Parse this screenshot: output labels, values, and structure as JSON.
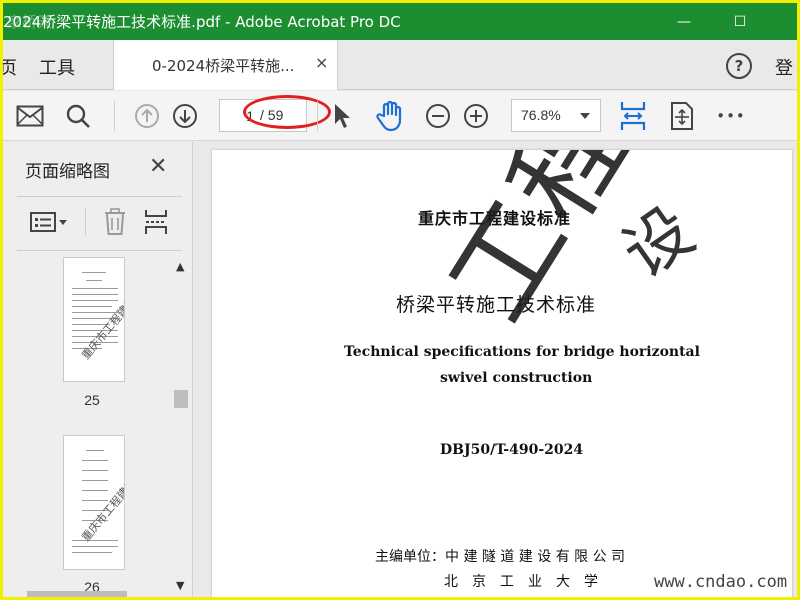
{
  "window": {
    "title": "2024桥梁平转施工技术标准.pdf - Adobe Acrobat Pro DC",
    "corner_watermark": "家桥天",
    "minimize": "—",
    "maximize": "☐"
  },
  "menubar": {
    "home_partial": "页",
    "tools": "工具",
    "tab_label": "0-2024桥梁平转施...",
    "tab_close": "×",
    "help": "?",
    "login_partial": "登"
  },
  "toolbar": {
    "current_page": "1",
    "total_pages": "/ 59",
    "zoom": "76.8%",
    "more": "•••"
  },
  "sidepanel": {
    "title": "页面缩略图",
    "close": "✕",
    "thumb_watermark": "重庆市工程建设",
    "pages": [
      {
        "number": "25"
      },
      {
        "number": "26"
      }
    ]
  },
  "document": {
    "header": "重庆市工程建设标准",
    "title_cn": "桥梁平转施工技术标准",
    "title_en_line1": "Technical specifications for bridge horizontal",
    "title_en_line2": "swivel construction",
    "code": "DBJ50/T-490-2024",
    "editor_label": "主编单位：中 建 隧 道 建 设 有 限 公 司",
    "coeditor": "北　京　工　业　大　学",
    "watermark": "工程建设",
    "watermark_tail": "设",
    "site_watermark": "www.cndao.com"
  },
  "colors": {
    "titlebar": "#1c8e31",
    "outer_frame": "#f0f000",
    "annotation": "#e02020",
    "active_tool": "#1a6fd8"
  }
}
